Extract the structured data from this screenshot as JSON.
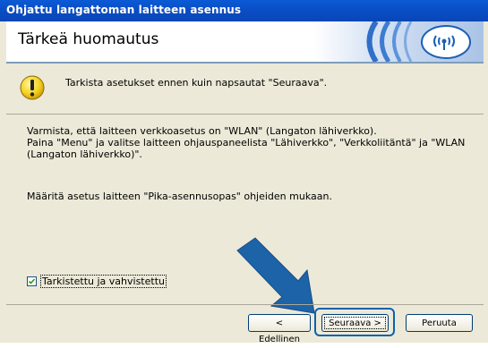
{
  "window": {
    "title": "Ohjattu langattoman laitteen asennus"
  },
  "banner": {
    "heading": "Tärkeä huomautus"
  },
  "warning": {
    "text": "Tarkista asetukset ennen kuin napsautat \"Seuraava\"."
  },
  "body": {
    "line1": "Varmista, että laitteen verkkoasetus on \"WLAN\" (Langaton lähiverkko).",
    "line2": "Paina \"Menu\" ja valitse laitteen ohjauspaneelista \"Lähiverkko\", \"Verkkoliitäntä\" ja \"WLAN (Langaton lähiverkko)\".",
    "instruction": "Määritä asetus laitteen \"Pika-asennusopas\" ohjeiden mukaan."
  },
  "checkbox": {
    "label": "Tarkistettu ja vahvistettu",
    "checked": true
  },
  "buttons": {
    "back": "< Edellinen",
    "next": "Seuraava >",
    "cancel": "Peruuta"
  },
  "colors": {
    "titlebar": "#0a4fc7",
    "accent": "#1a62b8",
    "arrow": "#1d63a8"
  }
}
